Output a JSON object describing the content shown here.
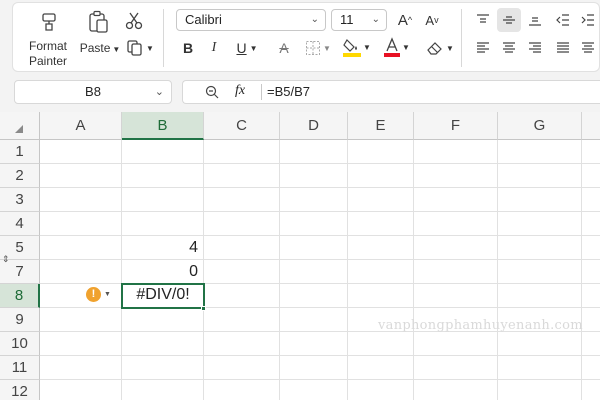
{
  "ribbon": {
    "clipboard": {
      "format_painter_label": "Format",
      "format_painter_label2": "Painter",
      "paste_label": "Paste",
      "cut_icon": "scissors-icon",
      "copy_icon": "copy-icon",
      "format_painter_icon": "paintbrush-icon",
      "paste_icon": "clipboard-icon"
    },
    "font": {
      "font_name": "Calibri",
      "font_size": "11",
      "bold": "B",
      "italic": "I",
      "underline": "U",
      "grow_font": "A",
      "shrink_font": "A",
      "font_color_accent": "#e81123",
      "highlight_accent": "#ffd800"
    }
  },
  "formula_bar": {
    "name_box": "B8",
    "fx_label": "fx",
    "formula": "=B5/B7"
  },
  "grid": {
    "columns": [
      "A",
      "B",
      "C",
      "D",
      "E",
      "F",
      "G"
    ],
    "rows": [
      "1",
      "2",
      "3",
      "4",
      "5",
      "7",
      "8",
      "9",
      "10",
      "11",
      "12"
    ],
    "active_column": "B",
    "active_row": "8",
    "cells": {
      "B5": "4",
      "B7": "0",
      "B8": "#DIV/0!"
    },
    "error_indicator_icon": "warning-icon",
    "accent_color": "#217346"
  },
  "watermark": "vanphongphamhuyenanh.com"
}
